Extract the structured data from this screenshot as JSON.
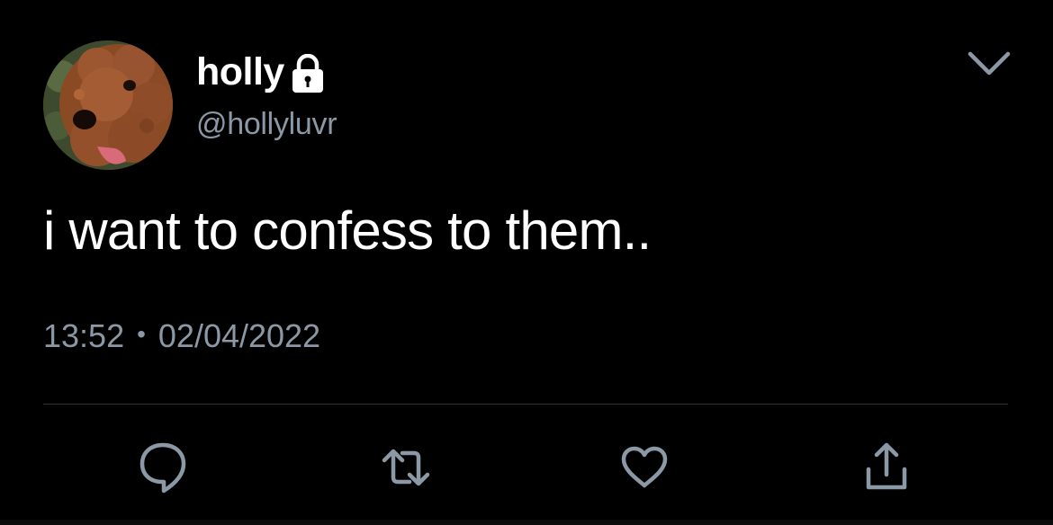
{
  "user": {
    "display_name": "holly",
    "handle": "@hollyluvr",
    "avatar_icon": "poodle-avatar",
    "protected_icon": "lock-icon"
  },
  "tweet": {
    "text": "i want to confess to them..",
    "time": "13:52",
    "separator": "•",
    "date": "02/04/2022"
  },
  "actions": [
    {
      "icon": "reply-icon"
    },
    {
      "icon": "retweet-icon"
    },
    {
      "icon": "like-icon"
    },
    {
      "icon": "share-icon"
    }
  ],
  "colors": {
    "background": "#000000",
    "text_primary": "#ffffff",
    "text_secondary": "#8b98a5",
    "divider": "#2f3336",
    "icon": "#8b98a5"
  }
}
